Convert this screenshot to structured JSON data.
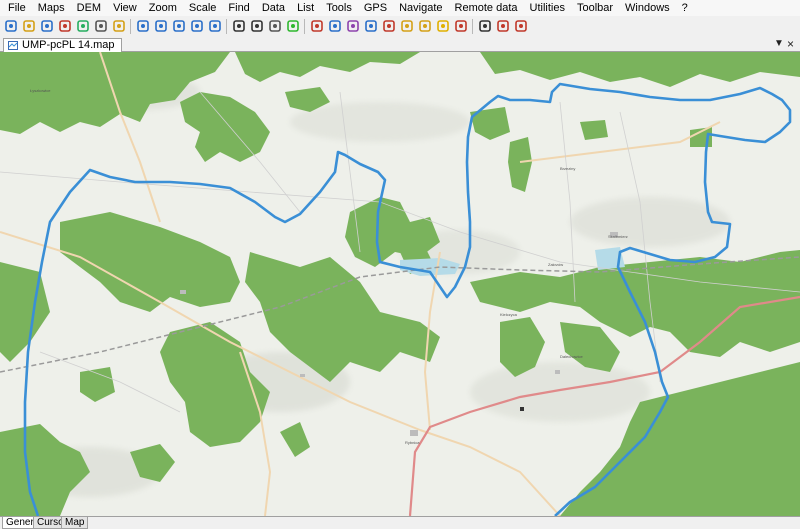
{
  "menu": [
    "File",
    "Maps",
    "DEM",
    "View",
    "Zoom",
    "Scale",
    "Find",
    "Data",
    "List",
    "Tools",
    "GPS",
    "Navigate",
    "Remote data",
    "Utilities",
    "Toolbar",
    "Windows",
    "?"
  ],
  "toolbar_icons": [
    "open-file-icon",
    "open-map-icon",
    "save-icon",
    "export-icon",
    "import-icon",
    "print-icon",
    "properties-icon",
    "search-icon",
    "zoom-in-icon",
    "zoom-out-icon",
    "zoom-fit-icon",
    "zoom-actual-icon",
    "select-icon",
    "pointer-icon",
    "move-icon",
    "gps-icon",
    "draw-point-icon",
    "draw-line-icon",
    "draw-polygon-icon",
    "edit-nodes-icon",
    "delete-icon",
    "flag-icon",
    "tag-icon",
    "join-icon",
    "split-icon",
    "measure-icon",
    "layer-up-icon",
    "layer-down-icon"
  ],
  "document_tab": "UMP-pcPL 14.map",
  "bottom_tabs": [
    "General",
    "Cursor",
    "Map"
  ],
  "colors": {
    "map_background": "#eef0ea",
    "forest": "#7ab35c",
    "route": "#3a8fd6",
    "main_road": "#e08a8a",
    "secondary_road": "#f0d6b0",
    "railway": "#9a9a9a",
    "water": "#b5dbe8"
  },
  "map_labels": [
    "Brzeziny",
    "Kielczyca",
    "Rybnica",
    "Skalbmierz",
    "Zakrzów",
    "Dalechowice",
    "Łyszkowice"
  ]
}
